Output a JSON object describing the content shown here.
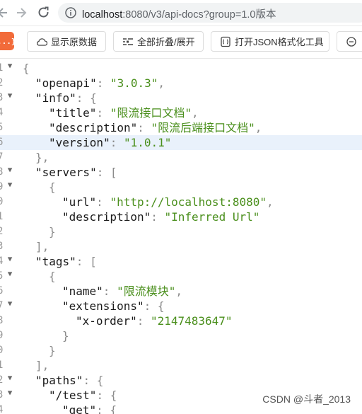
{
  "browser": {
    "url_host": "localhost",
    "url_rest": ":8080/v3/api-docs?group=1.0版本"
  },
  "toolbar": {
    "logo_label": "{...}",
    "show_raw_label": "显示原数据",
    "toggle_all_label": "全部折叠/展开",
    "open_formatter_label": "打开JSON格式化工具"
  },
  "json": {
    "l1": "{",
    "openapi_key": "\"openapi\"",
    "openapi_val": "\"3.0.3\"",
    "info_key": "\"info\"",
    "title_key": "\"title\"",
    "title_val": "\"限流接口文档\"",
    "description_key": "\"description\"",
    "description_val": "\"限流后端接口文档\"",
    "version_key": "\"version\"",
    "version_val": "\"1.0.1\"",
    "servers_key": "\"servers\"",
    "url_key": "\"url\"",
    "url_val": "\"http://localhost:8080\"",
    "server_desc_key": "\"description\"",
    "server_desc_val": "\"Inferred Url\"",
    "tags_key": "\"tags\"",
    "name_key": "\"name\"",
    "name_val": "\"限流模块\"",
    "extensions_key": "\"extensions\"",
    "xorder_key": "\"x-order\"",
    "xorder_val": "\"2147483647\"",
    "paths_key": "\"paths\"",
    "test_key": "\"/test\"",
    "get_key": "\"get\""
  },
  "watermark": "CSDN @斗者_2013",
  "colors": {
    "key": "#1a1a1a",
    "string": "#4a8f1c",
    "punctuation": "#8a8a8a",
    "highlight": "#e9f1fb",
    "logo": "#f26b3a"
  }
}
